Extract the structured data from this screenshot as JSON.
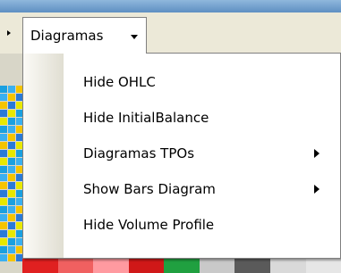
{
  "menu": {
    "title": "Diagramas",
    "items": [
      {
        "label": "Hide OHLC",
        "has_submenu": false
      },
      {
        "label": "Hide InitialBalance",
        "has_submenu": false
      },
      {
        "label": "Diagramas TPOs",
        "has_submenu": true
      },
      {
        "label": "Show Bars Diagram",
        "has_submenu": true
      },
      {
        "label": "Hide Volume Profile",
        "has_submenu": false
      }
    ]
  },
  "colors": {
    "menubar": "#ece9d8",
    "menu_border": "#808080",
    "title_bar": "#6b9ad0",
    "bg_cells_left": [
      "#3ab0f0",
      "#f5c400",
      "#2a7ad8",
      "#e8e800",
      "#1aa0e0"
    ],
    "bg_cells_bottom": [
      "#e02020",
      "#f06060",
      "#ff9aa0",
      "#d01818",
      "#20a040",
      "#c9c9c9",
      "#5a5a5a",
      "#d9d9d9",
      "#e6e6e6"
    ]
  }
}
